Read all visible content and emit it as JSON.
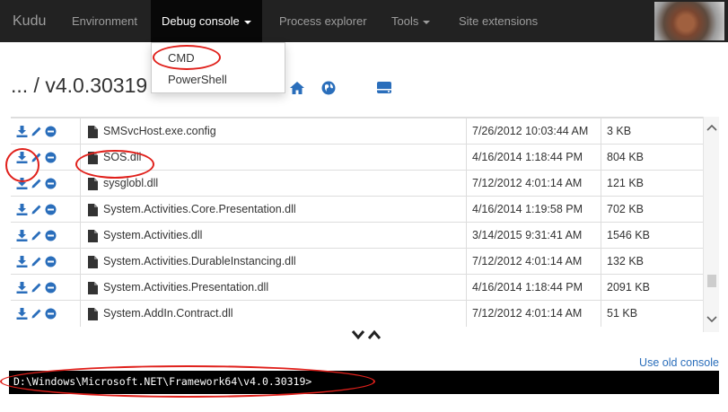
{
  "navbar": {
    "brand": "Kudu",
    "items": [
      {
        "label": "Environment"
      },
      {
        "label": "Debug console"
      },
      {
        "label": "Process explorer"
      },
      {
        "label": "Tools"
      },
      {
        "label": "Site extensions"
      }
    ]
  },
  "dropdown": {
    "items": [
      {
        "label": "CMD"
      },
      {
        "label": "PowerShell"
      }
    ]
  },
  "breadcrumb": {
    "path": "... / v4.0.30319"
  },
  "icons": {
    "download": "download-icon",
    "edit": "pencil-icon",
    "delete": "minus-circle-icon",
    "file": "file-icon",
    "home": "home-icon",
    "globe": "globe-icon",
    "drive": "hard-drive-icon"
  },
  "colors": {
    "navbar_bg": "#222222",
    "action_icon": "#2a6ebb",
    "highlight": "#e0201b"
  },
  "files": [
    {
      "name": "SMSvcHost.exe.config",
      "modified": "7/26/2012 10:03:44 AM",
      "size": "3 KB"
    },
    {
      "name": "SOS.dll",
      "modified": "4/16/2014 1:18:44 PM",
      "size": "804 KB"
    },
    {
      "name": "sysglobl.dll",
      "modified": "7/12/2012 4:01:14 AM",
      "size": "121 KB"
    },
    {
      "name": "System.Activities.Core.Presentation.dll",
      "modified": "4/16/2014 1:19:58 PM",
      "size": "702 KB"
    },
    {
      "name": "System.Activities.dll",
      "modified": "3/14/2015 9:31:41 AM",
      "size": "1546 KB"
    },
    {
      "name": "System.Activities.DurableInstancing.dll",
      "modified": "7/12/2012 4:01:14 AM",
      "size": "132 KB"
    },
    {
      "name": "System.Activities.Presentation.dll",
      "modified": "4/16/2014 1:18:44 PM",
      "size": "2091 KB"
    },
    {
      "name": "System.AddIn.Contract.dll",
      "modified": "7/12/2012 4:01:14 AM",
      "size": "51 KB"
    }
  ],
  "console": {
    "old_console_link": "Use old console",
    "prompt": "D:\\Windows\\Microsoft.NET\\Framework64\\v4.0.30319>"
  }
}
